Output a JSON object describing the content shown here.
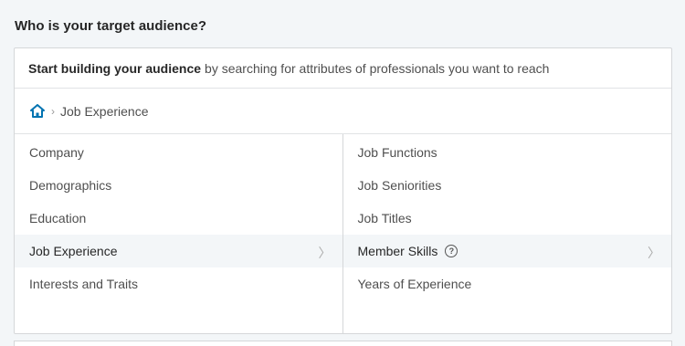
{
  "section": {
    "title": "Who is your target audience?"
  },
  "intro": {
    "bold": "Start building your audience",
    "rest": "by searching for attributes of professionals you want to reach"
  },
  "breadcrumb": {
    "home_icon": "home-icon",
    "current": "Job Experience"
  },
  "categories": [
    {
      "label": "Company"
    },
    {
      "label": "Demographics"
    },
    {
      "label": "Education"
    },
    {
      "label": "Job Experience",
      "active": true
    },
    {
      "label": "Interests and Traits"
    }
  ],
  "subcategories": [
    {
      "label": "Job Functions"
    },
    {
      "label": "Job Seniorities"
    },
    {
      "label": "Job Titles"
    },
    {
      "label": "Member Skills",
      "active": true,
      "help": "?"
    },
    {
      "label": "Years of Experience"
    }
  ],
  "colors": {
    "home_icon": "#0073b1",
    "active_row": "#f3f6f8"
  }
}
